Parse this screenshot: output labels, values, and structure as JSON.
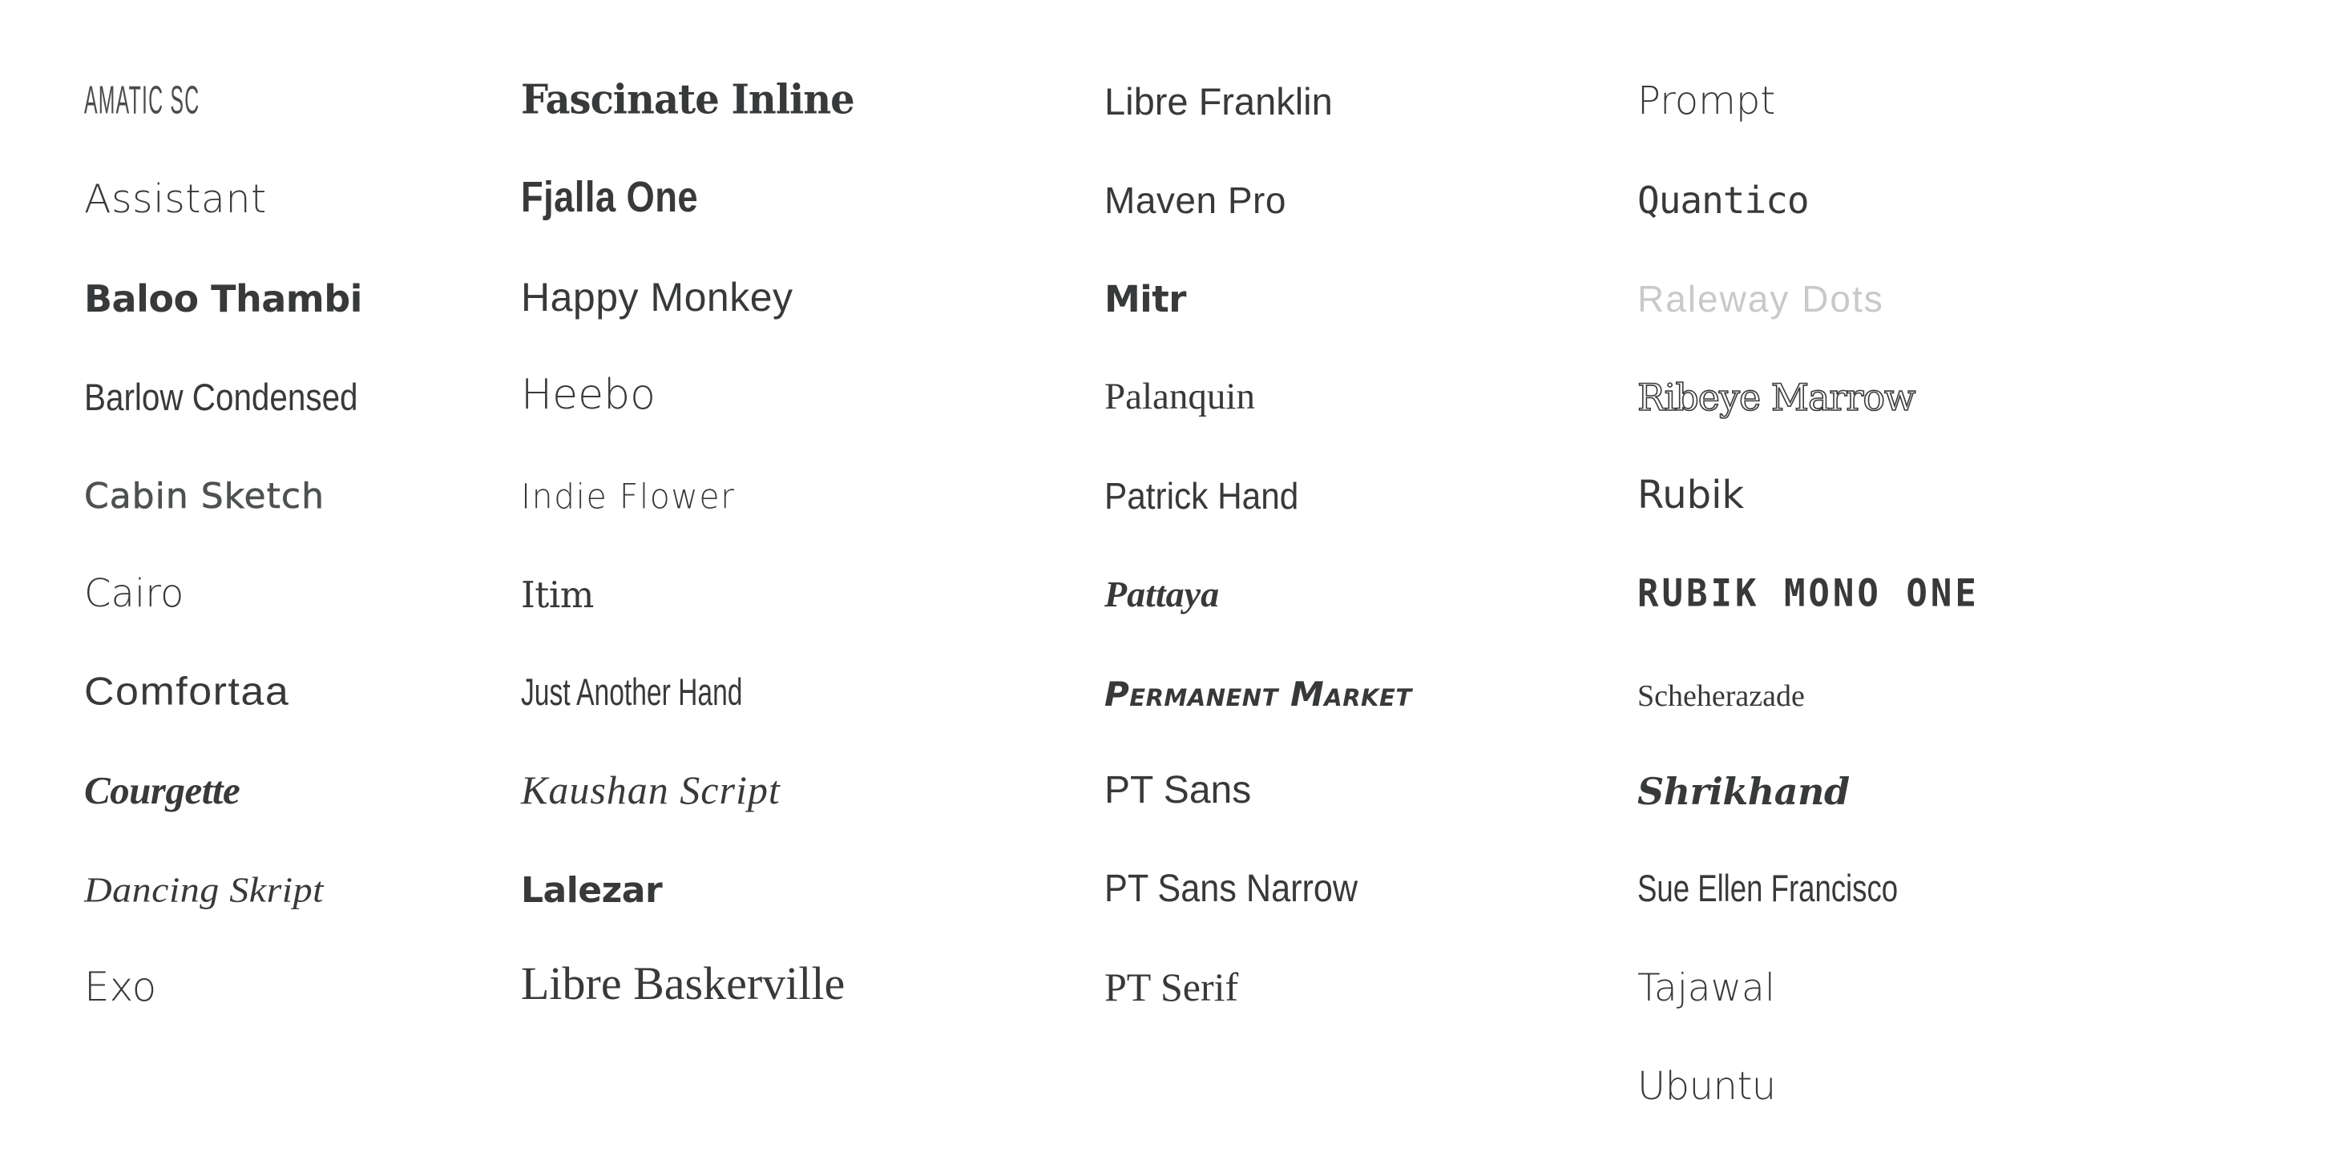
{
  "page": {
    "title": "Google Font Specimen Sheet",
    "background_color": "#ffffff",
    "text_color": "#37393a",
    "muted_text_color": "#c9c9c9",
    "columns_count": 4,
    "rows_per_column": [
      10,
      10,
      10,
      11
    ],
    "total_fonts": 41
  },
  "columns": [
    {
      "index": 1,
      "items": [
        {
          "name": "Amatic Sc",
          "style_class": "s-amatic",
          "row": 0
        },
        {
          "name": "Assistant",
          "style_class": "s-assistant",
          "row": 1
        },
        {
          "name": "Baloo Thambi",
          "style_class": "s-baloo",
          "row": 2
        },
        {
          "name": "Barlow Condensed",
          "style_class": "s-barlowcond",
          "row": 3
        },
        {
          "name": "Cabin Sketch",
          "style_class": "s-cabinsk",
          "row": 4
        },
        {
          "name": "Cairo",
          "style_class": "s-cairo",
          "row": 5
        },
        {
          "name": "Comfortaa",
          "style_class": "s-comfortaa",
          "row": 6
        },
        {
          "name": "Courgette",
          "style_class": "s-courgette",
          "row": 7
        },
        {
          "name": "Dancing Skript",
          "style_class": "s-dancing",
          "row": 8
        },
        {
          "name": "Exo",
          "style_class": "s-exo",
          "row": 9
        }
      ]
    },
    {
      "index": 2,
      "items": [
        {
          "name": "Fascinate Inline",
          "style_class": "s-fascinate",
          "row": 0
        },
        {
          "name": "Fjalla One",
          "style_class": "s-fjalla",
          "row": 1
        },
        {
          "name": "Happy Monkey",
          "style_class": "s-happymonk",
          "row": 2
        },
        {
          "name": "Heebo",
          "style_class": "s-heebo",
          "row": 3
        },
        {
          "name": "Indie Flower",
          "style_class": "s-indie",
          "row": 4
        },
        {
          "name": "Itim",
          "style_class": "s-itim",
          "row": 5
        },
        {
          "name": "Just Another Hand",
          "style_class": "s-justanoth",
          "row": 6
        },
        {
          "name": "Kaushan Script",
          "style_class": "s-kaushan",
          "row": 7
        },
        {
          "name": "Lalezar",
          "style_class": "s-lalezar",
          "row": 8
        },
        {
          "name": "Libre Baskerville",
          "style_class": "s-librebask",
          "row": 9
        }
      ]
    },
    {
      "index": 3,
      "items": [
        {
          "name": "Libre Franklin",
          "style_class": "s-librefrank",
          "row": 0
        },
        {
          "name": "Maven Pro",
          "style_class": "s-maven",
          "row": 1
        },
        {
          "name": "Mitr",
          "style_class": "s-mitr",
          "row": 2
        },
        {
          "name": "Palanquin",
          "style_class": "s-palanquin",
          "row": 3
        },
        {
          "name": "Patrick Hand",
          "style_class": "s-patrick",
          "row": 4
        },
        {
          "name": "Pattaya",
          "style_class": "s-pattaya",
          "row": 5
        },
        {
          "name": "Permanent Market",
          "style_class": "s-permanent",
          "row": 6
        },
        {
          "name": "PT Sans",
          "style_class": "s-ptsans",
          "row": 7
        },
        {
          "name": "PT Sans Narrow",
          "style_class": "s-ptsansnar",
          "row": 8
        },
        {
          "name": "PT Serif",
          "style_class": "s-ptserif",
          "row": 9
        }
      ]
    },
    {
      "index": 4,
      "items": [
        {
          "name": "Prompt",
          "style_class": "s-prompt",
          "row": 0
        },
        {
          "name": "Quantico",
          "style_class": "s-quantico",
          "row": 1
        },
        {
          "name": "Raleway Dots",
          "style_class": "s-ralewaydot",
          "row": 2
        },
        {
          "name": "Ribeye Marrow",
          "style_class": "s-ribeye",
          "row": 3
        },
        {
          "name": "Rubik",
          "style_class": "s-rubik",
          "row": 4
        },
        {
          "name": "Rubik Mono One",
          "style_class": "s-rubikmono",
          "row": 5
        },
        {
          "name": "Scheherazade",
          "style_class": "s-scheher",
          "row": 6
        },
        {
          "name": "Shrikhand",
          "style_class": "s-shrikhand",
          "row": 7
        },
        {
          "name": "Sue Ellen Francisco",
          "style_class": "s-sueellen",
          "row": 8
        },
        {
          "name": "Tajawal",
          "style_class": "s-tajawal",
          "row": 9
        },
        {
          "name": "Ubuntu",
          "style_class": "s-ubuntu",
          "row": 10
        }
      ]
    }
  ]
}
